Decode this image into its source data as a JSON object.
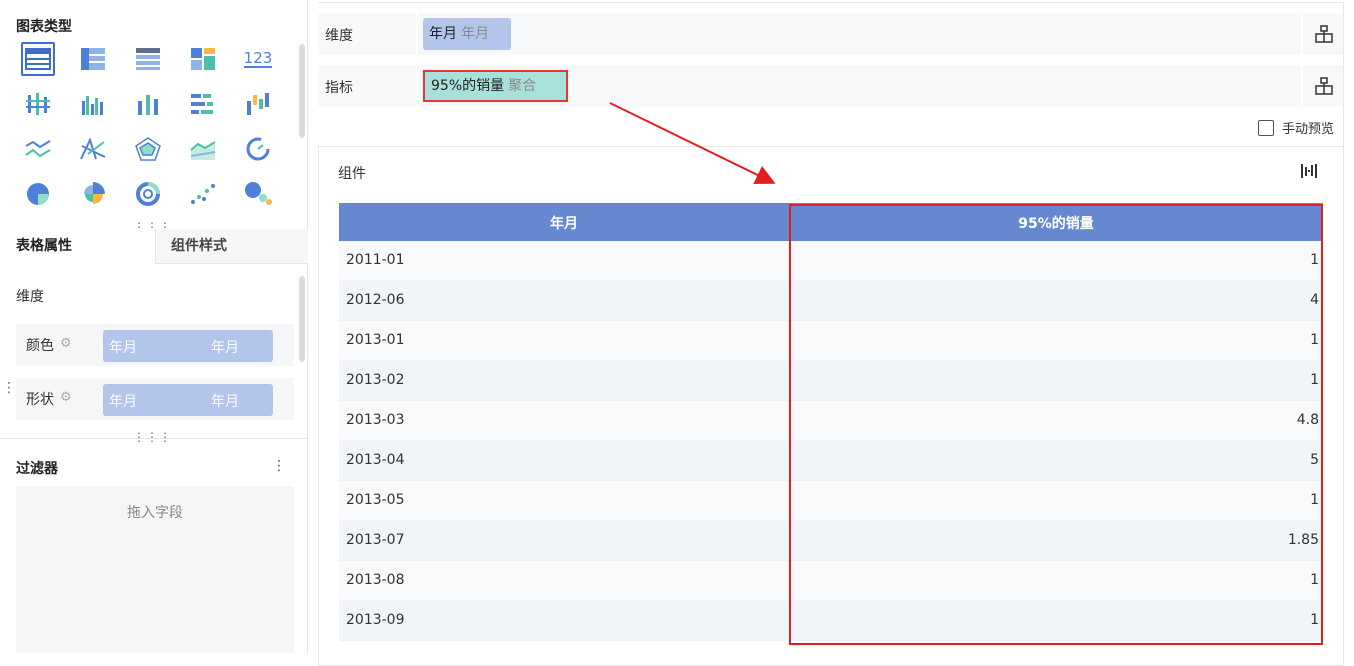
{
  "left_panel": {
    "chart_type_title": "图表类型",
    "chart_icons": [
      "table-icon",
      "cross-table-icon",
      "detail-table-icon",
      "grid-kpi-icon",
      "number-card-icon",
      "bar-range-icon",
      "grouped-column-icon",
      "stacked-column-icon",
      "horizontal-bar-icon",
      "waterfall-icon",
      "line-icon",
      "radar-line-icon",
      "radar-icon",
      "area-icon",
      "gauge-icon",
      "pie-icon",
      "rose-pie-icon",
      "ring-icon",
      "scatter-icon",
      "bubble-icon"
    ],
    "number_icon_text": "123",
    "tabs": {
      "active": "表格属性",
      "inactive": "组件样式"
    },
    "dimension_label": "维度",
    "attrs": [
      {
        "label": "颜色",
        "left_text": "年月",
        "right_text": "年月"
      },
      {
        "label": "形状",
        "left_text": "年月",
        "right_text": "年月"
      }
    ],
    "filter": {
      "title": "过滤器",
      "more": "⋮",
      "drop_hint": "拖入字段"
    }
  },
  "right_panel": {
    "dimension": {
      "label": "维度",
      "field": "年月",
      "sub": "年月"
    },
    "measure": {
      "label": "指标",
      "field": "95%的销量",
      "sub": "聚合"
    },
    "manual_preview": "手动预览",
    "card_title": "组件",
    "table": {
      "headers": [
        "年月",
        "95%的销量"
      ],
      "rows": [
        [
          "2011-01",
          "1"
        ],
        [
          "2012-06",
          "4"
        ],
        [
          "2013-01",
          "1"
        ],
        [
          "2013-02",
          "1"
        ],
        [
          "2013-03",
          "4.8"
        ],
        [
          "2013-04",
          "5"
        ],
        [
          "2013-05",
          "1"
        ],
        [
          "2013-07",
          "1.85"
        ],
        [
          "2013-08",
          "1"
        ],
        [
          "2013-09",
          "1"
        ]
      ]
    }
  },
  "colors": {
    "accent": "#3d6ec9",
    "header_bg": "#6588d1",
    "dim_pill": "#b3c5eb",
    "measure_pill": "#a8e0db",
    "highlight": "#e02020"
  }
}
